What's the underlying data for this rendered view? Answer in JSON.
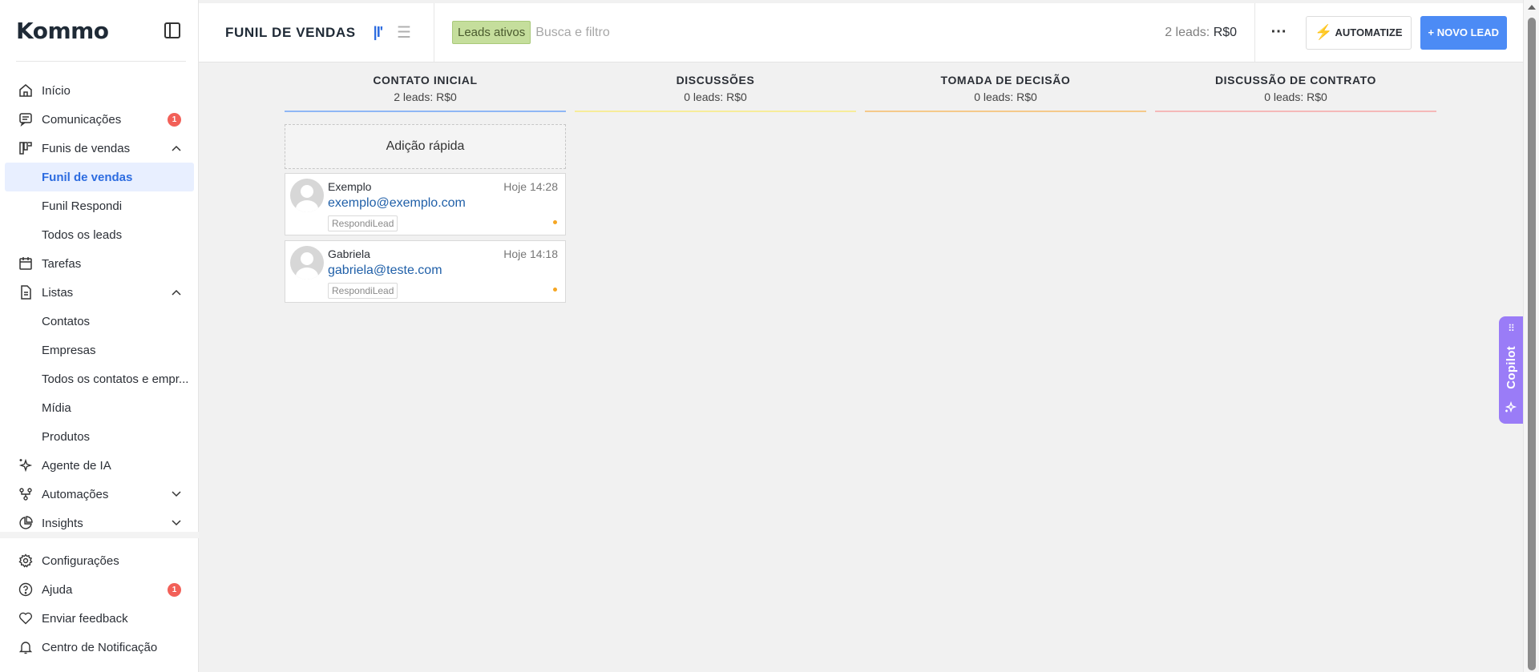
{
  "brand": {
    "logo_text": "Kommo"
  },
  "sidebar": {
    "items": [
      {
        "label": "Início",
        "icon": "home-icon"
      },
      {
        "label": "Comunicações",
        "icon": "chat-icon",
        "badge": "1"
      },
      {
        "label": "Funis de vendas",
        "icon": "kanban-icon",
        "expanded": true
      },
      {
        "label": "Funil de vendas",
        "sub": true,
        "active": true
      },
      {
        "label": "Funil Respondi",
        "sub": true
      },
      {
        "label": "Todos os leads",
        "sub": true
      },
      {
        "label": "Tarefas",
        "icon": "calendar-icon"
      },
      {
        "label": "Listas",
        "icon": "document-icon",
        "expanded": true
      },
      {
        "label": "Contatos",
        "sub": true
      },
      {
        "label": "Empresas",
        "sub": true
      },
      {
        "label": "Todos os contatos e empr...",
        "sub": true
      },
      {
        "label": "Mídia",
        "sub": true
      },
      {
        "label": "Produtos",
        "sub": true
      },
      {
        "label": "Agente de IA",
        "icon": "sparkle-icon"
      },
      {
        "label": "Automações",
        "icon": "flow-icon",
        "expanded": false
      },
      {
        "label": "Insights",
        "icon": "pie-chart-icon",
        "expanded": false
      }
    ],
    "bottom": [
      {
        "label": "Configurações",
        "icon": "gear-icon"
      },
      {
        "label": "Ajuda",
        "icon": "help-icon",
        "badge": "1"
      },
      {
        "label": "Enviar feedback",
        "icon": "heart-icon"
      },
      {
        "label": "Centro de Notificação",
        "icon": "bell-icon"
      }
    ]
  },
  "header": {
    "title": "FUNIL DE VENDAS",
    "filter_tag": "Leads ativos",
    "search_placeholder": "Busca e filtro",
    "summary_prefix": "2 leads:",
    "summary_value": "R$0",
    "more_label": "···",
    "automate_label": "AUTOMATIZE",
    "new_lead_label": "+ NOVO LEAD"
  },
  "columns": [
    {
      "title": "CONTATO INICIAL",
      "subtitle": "2 leads: R$0",
      "color": "#8fb7f5"
    },
    {
      "title": "DISCUSSÕES",
      "subtitle": "0 leads: R$0",
      "color": "#f7ec9a"
    },
    {
      "title": "TOMADA DE DECISÃO",
      "subtitle": "0 leads: R$0",
      "color": "#f5c98a"
    },
    {
      "title": "DISCUSSÃO DE CONTRATO",
      "subtitle": "0 leads: R$0",
      "color": "#f5b9b9"
    }
  ],
  "quick_add": "Adição rápida",
  "cards": [
    {
      "name": "Exemplo",
      "time": "Hoje 14:28",
      "email": "exemplo@exemplo.com",
      "tag": "RespondiLead"
    },
    {
      "name": "Gabriela",
      "time": "Hoje 14:18",
      "email": "gabriela@teste.com",
      "tag": "RespondiLead"
    }
  ],
  "copilot": {
    "label": "Copilot"
  }
}
